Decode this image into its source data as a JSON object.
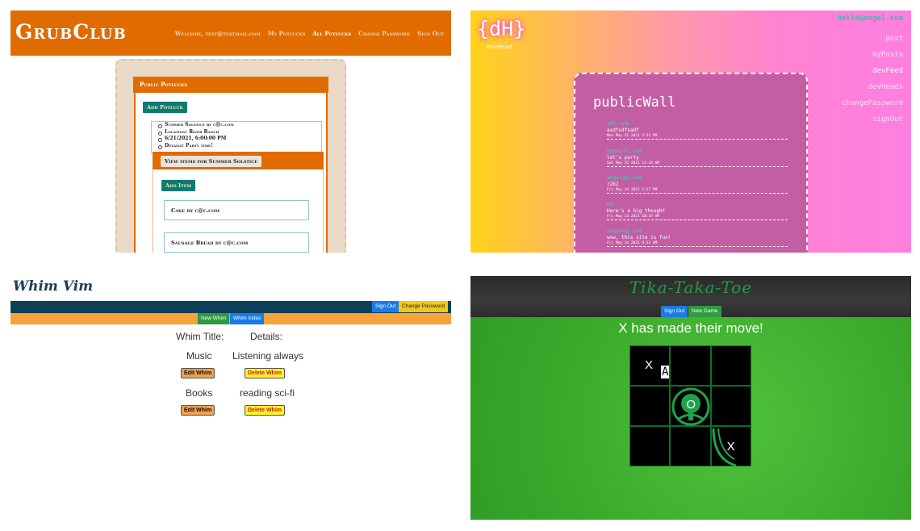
{
  "grubclub": {
    "logo": "GrubClub",
    "nav": [
      "Welcome, test@testmail.com",
      "My Potlucks",
      "All Potlucks",
      "Change Password",
      "Sign Out"
    ],
    "card_title": "Public Potlucks",
    "add_potluck": "Add Potluck",
    "details": [
      "Summer Solstice by c@c.com",
      "Location: River Ranch",
      "6/21/2021, 6:00:00 PM",
      "Details: Party time!"
    ],
    "view_items": "View items for Summer Solstice",
    "add_item": "Add Item",
    "items": [
      "Cake by c@c.com",
      "Sausage Bread by c@c.com"
    ]
  },
  "devhead": {
    "logo": "{dH}",
    "logo_sub": "devHead",
    "email": "hello@angel.com",
    "menu": [
      "post",
      "myPosts",
      "devFeed",
      "devHeads",
      "changePassword",
      "signOut"
    ],
    "wall_title": "publicWall",
    "posts": [
      {
        "author": "a@b.com",
        "text": "asdfsdfsadf",
        "date": "Mon May 31 2021 4:21 PM"
      },
      {
        "author": "h@gmail.com",
        "text": "let's party",
        "date": "Sat May 15 2021 11:14 AM"
      },
      {
        "author": "angel@h.com",
        "text": "r2b2",
        "date": "Fri May 14 2021 2:27 PM"
      },
      {
        "author": "m@",
        "text": "Here's a big thought",
        "date": "Fri May 14 2021 10:19 AM"
      },
      {
        "author": "dog@dog.com",
        "text": "wow, this site is fun!",
        "date": "Fri May 14 2021 9:12 AM"
      }
    ]
  },
  "whimvim": {
    "title": "Whim Vim",
    "sign_out": "Sign Out",
    "change_password": "Change Password",
    "new_whim": "New Whim",
    "whim_index": "Whim Index",
    "col_title": "Whim Title:",
    "col_details": "Details:",
    "rows": [
      {
        "title": "Music",
        "details": "Listening always"
      },
      {
        "title": "Books",
        "details": "reading sci-fi"
      }
    ],
    "edit_label": "Edit Whim",
    "delete_label": "Delete Whim"
  },
  "tictactoe": {
    "title": "Tika-Taka-Toe",
    "sign_out": "Sign Out",
    "new_game": "New Game",
    "message": "X has made their move!",
    "board": [
      "X",
      "",
      "",
      "",
      "O",
      "",
      "",
      "",
      "X"
    ]
  },
  "colors": {
    "grub_orange": "#e06c00",
    "grub_teal": "#0e7a73",
    "dh_teal": "#38d4b9",
    "whim_navy": "#0d3f59",
    "whim_orange": "#f5a33a",
    "btn_blue": "#1a7be8",
    "btn_green": "#2e9b43",
    "ttt_green": "#1f9e3f"
  }
}
